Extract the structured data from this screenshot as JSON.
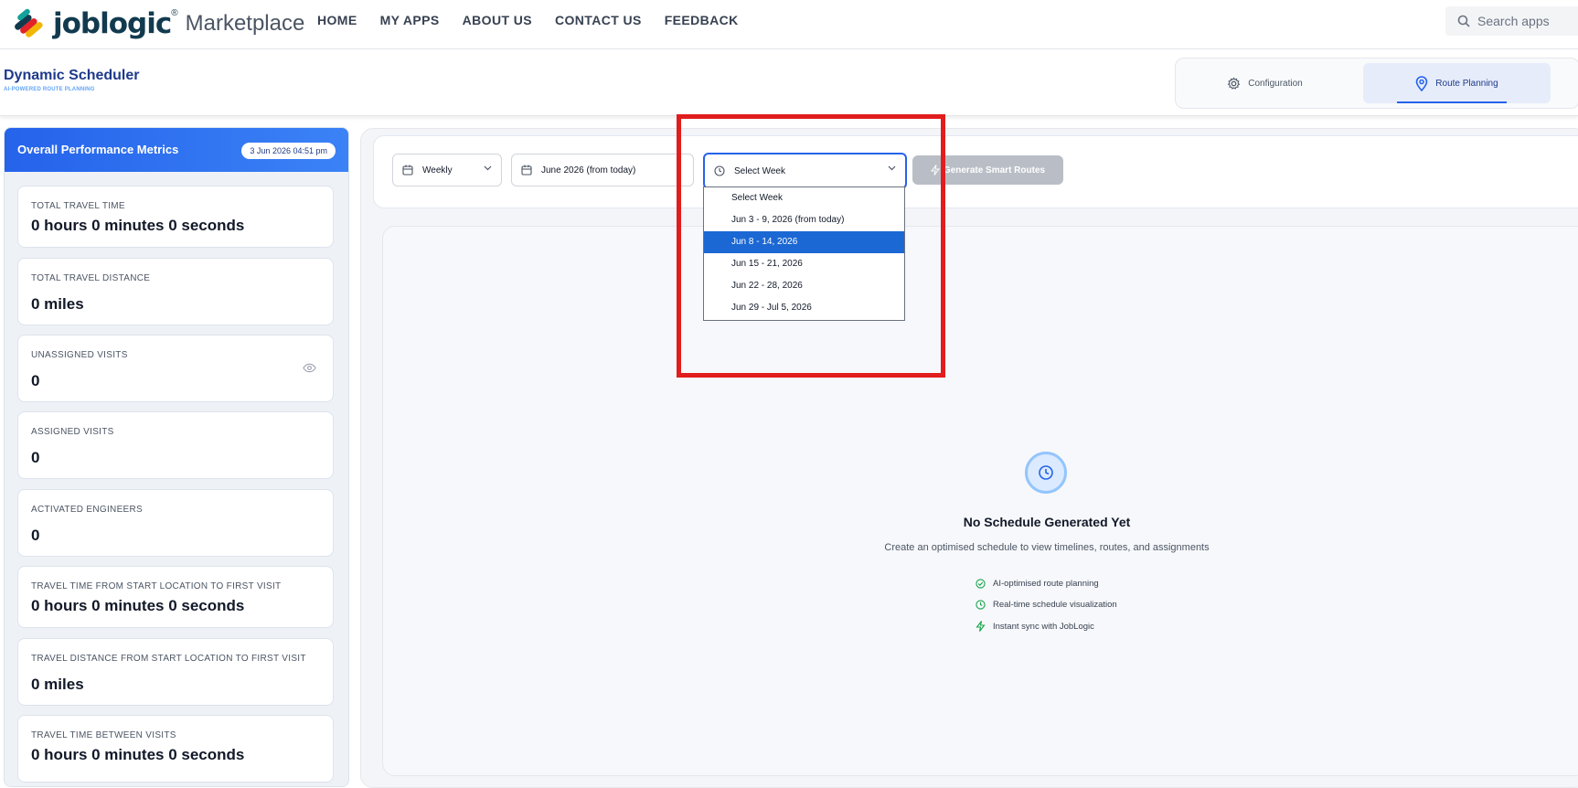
{
  "nav": {
    "logo_text": "joblogic",
    "logo_reg": "®",
    "logo_suffix": "Marketplace",
    "links": [
      "HOME",
      "MY APPS",
      "ABOUT US",
      "CONTACT US",
      "FEEDBACK"
    ],
    "search_placeholder": "Search apps"
  },
  "header": {
    "title": "Dynamic Scheduler",
    "subtitle": "AI-POWERED ROUTE PLANNING",
    "tabs": [
      {
        "label": "Configuration",
        "icon": "gear-icon",
        "active": false
      },
      {
        "label": "Route Planning",
        "icon": "map-pin-icon",
        "active": true
      }
    ]
  },
  "metrics": {
    "title": "Overall Performance Metrics",
    "date": "3 Jun 2026 04:51 pm",
    "cards": [
      {
        "label": "TOTAL TRAVEL TIME",
        "value": "0 hours 0 minutes 0 seconds"
      },
      {
        "label": "TOTAL TRAVEL DISTANCE",
        "value": "0 miles"
      },
      {
        "label": "UNASSIGNED VISITS",
        "value": "0",
        "icon": "eye-icon"
      },
      {
        "label": "ASSIGNED VISITS",
        "value": "0"
      },
      {
        "label": "ACTIVATED ENGINEERS",
        "value": "0"
      },
      {
        "label": "TRAVEL TIME FROM START LOCATION TO FIRST VISIT",
        "value": "0 hours 0 minutes 0 seconds"
      },
      {
        "label": "TRAVEL DISTANCE FROM START LOCATION TO FIRST VISIT",
        "value": "0 miles"
      },
      {
        "label": "TRAVEL TIME BETWEEN VISITS",
        "value": "0 hours 0 minutes 0 seconds"
      }
    ]
  },
  "filters": {
    "period": "Weekly",
    "month": "June 2026 (from today)",
    "week": "Select Week",
    "generate_label": "Generate Smart Routes"
  },
  "week_dropdown": {
    "options": [
      "Select Week",
      "Jun 3 - 9, 2026 (from today)",
      "Jun 8 - 14, 2026",
      "Jun 15 - 21, 2026",
      "Jun 22 - 28, 2026",
      "Jun 29 - Jul 5, 2026"
    ],
    "highlighted_index": 2
  },
  "empty_state": {
    "title": "No Schedule Generated Yet",
    "subtitle": "Create an optimised schedule to view timelines, routes, and assignments",
    "features": [
      {
        "label": "AI-optimised route planning",
        "icon": "check-circle-icon"
      },
      {
        "label": "Real-time schedule visualization",
        "icon": "clock-icon"
      },
      {
        "label": "Instant sync with JobLogic",
        "icon": "lightning-icon"
      }
    ]
  },
  "colors": {
    "brand_blue": "#2563eb",
    "dark_blue": "#1e3a8a",
    "highlight": "#1b68d4",
    "annotation_red": "#e11d1d",
    "success_green": "#16a34a"
  }
}
